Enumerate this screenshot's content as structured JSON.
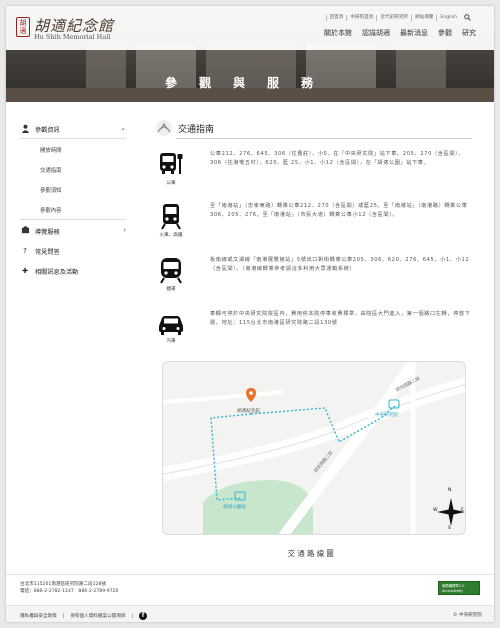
{
  "header": {
    "logo_cn": "胡適紀念館",
    "logo_en": "Hu Shih Memorial Hall",
    "seal_text": "胡適",
    "utility": [
      "回首頁",
      "中研院首頁",
      "近代史研究所",
      "網站導覽",
      "English"
    ],
    "nav": [
      "關於本館",
      "認識胡適",
      "最新消息",
      "參觀",
      "研究"
    ]
  },
  "hero": {
    "title": "參觀與服務"
  },
  "sidebar": {
    "sections": [
      {
        "label": "參觀資訊",
        "icon": "scholar-icon",
        "expanded": true,
        "items": [
          "開放時間",
          "交通指南",
          "參觀須知",
          "參觀內容"
        ]
      },
      {
        "label": "導覽服務",
        "icon": "guide-icon"
      },
      {
        "label": "常見問答",
        "icon": "question-icon"
      },
      {
        "label": "相關訊息及活動",
        "icon": "plus-icon"
      }
    ]
  },
  "page": {
    "title": "交通指南"
  },
  "modes": [
    {
      "label": "公車",
      "icon": "bus-icon",
      "text": "公車212、276、645、306（往舊莊）、小5、在「中央研究院」站下車。205、270（含區間）、306（往港墘五村）、620、藍 25、小1、小12（含區間），在「胡適公園」站下車。"
    },
    {
      "label": "火車、高鐵",
      "icon": "train-icon",
      "text": "至「南港站」（忠孝東路）轉乘公車212、270（含區間）或藍25。至「南港站」（南港路）轉乘公車306、205、276。至「南港站」（市民大道）轉乘公車小12（含區間）。"
    },
    {
      "label": "捷運",
      "icon": "metro-icon",
      "text": "板南線或文湖線「南港展覽館站」5號出口對街轉乘公車205、306、620、276、645、小1、小12（含區間）。（南港線轉乘參考請洽多利用大眾運輸系統）"
    },
    {
      "label": "汽車",
      "icon": "car-icon",
      "text": "車輛可停於中央研究院院區內，費用依本院停車收費標準，由院區大門進入，第一個路口左轉，停放下層。地址：115台北市南港區研究院路二段130號"
    }
  ],
  "map": {
    "labels": {
      "hall": "胡適紀念館",
      "academia": "中央研究院",
      "park": "胡適公園站",
      "road1": "研究院路二段",
      "road2": "研究院路二段"
    },
    "compass": {
      "n": "N",
      "s": "S",
      "e": "E",
      "w": "W"
    }
  },
  "map_caption": "交通路線圖",
  "footer": {
    "address": "台北市115201南港區研究院路二段128號",
    "phone": "電話：886-2-2782-1147　886-2-2789-9720",
    "badge_line1": "無障礙標章2.0",
    "badge_line2": "Accessibility",
    "links": [
      "隱私權與安全政策",
      "保有個人資料檔案公開項目"
    ],
    "copyright": "© 中央研究院"
  }
}
